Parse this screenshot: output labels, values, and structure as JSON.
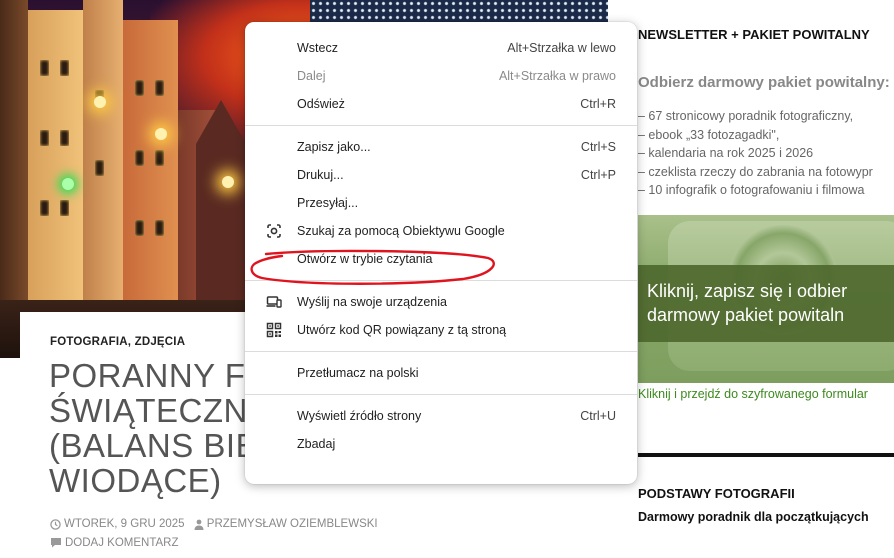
{
  "article": {
    "categories": "FOTOGRAFIA, ZDJĘCIA",
    "title_lines": [
      "PORANNY FO",
      "ŚWIĄTECZNI",
      "(BALANS BIEL",
      "WIODĄCE)"
    ],
    "date": "WTOREK, 9 GRU 2025",
    "author": "PRZEMYSŁAW OZIEMBLEWSKI",
    "comment": "DODAJ KOMENTARZ"
  },
  "sidebar": {
    "heading": "NEWSLETTER + PAKIET POWITALNY",
    "subheading": "Odbierz darmowy pakiet powitalny:",
    "list": [
      "– 67 stronicowy poradnik fotograficzny,",
      "– ebook „33 fotozagadki\",",
      "– kalendaria na rok 2025 i 2026",
      "– czeklista rzeczy do zabrania na fotowypr",
      "– 10 infografik o fotografowaniu i filmowa"
    ],
    "banner_line1": "Kliknij, zapisz się i odbier",
    "banner_line2": "darmowy pakiet powitaln",
    "link": "Kliknij i przejdź do szyfrowanego formular",
    "heading2": "PODSTAWY FOTOGRAFII",
    "text2": "Darmowy poradnik dla początkujących"
  },
  "menu": {
    "groups": [
      [
        {
          "label": "Wstecz",
          "shortcut": "Alt+Strzałka w lewo"
        },
        {
          "label": "Dalej",
          "shortcut": "Alt+Strzałka w prawo",
          "disabled": true
        },
        {
          "label": "Odśwież",
          "shortcut": "Ctrl+R"
        }
      ],
      [
        {
          "label": "Zapisz jako...",
          "shortcut": "Ctrl+S"
        },
        {
          "label": "Drukuj...",
          "shortcut": "Ctrl+P"
        },
        {
          "label": "Przesyłaj..."
        },
        {
          "label": "Szukaj za pomocą Obiektywu Google",
          "icon": "google-lens-icon"
        },
        {
          "label": "Otwórz w trybie czytania"
        }
      ],
      [
        {
          "label": "Wyślij na swoje urządzenia",
          "icon": "devices-icon"
        },
        {
          "label": "Utwórz kod QR powiązany z tą stroną",
          "icon": "qr-code-icon"
        }
      ],
      [
        {
          "label": "Przetłumacz na polski"
        }
      ],
      [
        {
          "label": "Wyświetl źródło strony",
          "shortcut": "Ctrl+U"
        },
        {
          "label": "Zbadaj"
        }
      ]
    ],
    "annotation_color": "#e0141e"
  }
}
